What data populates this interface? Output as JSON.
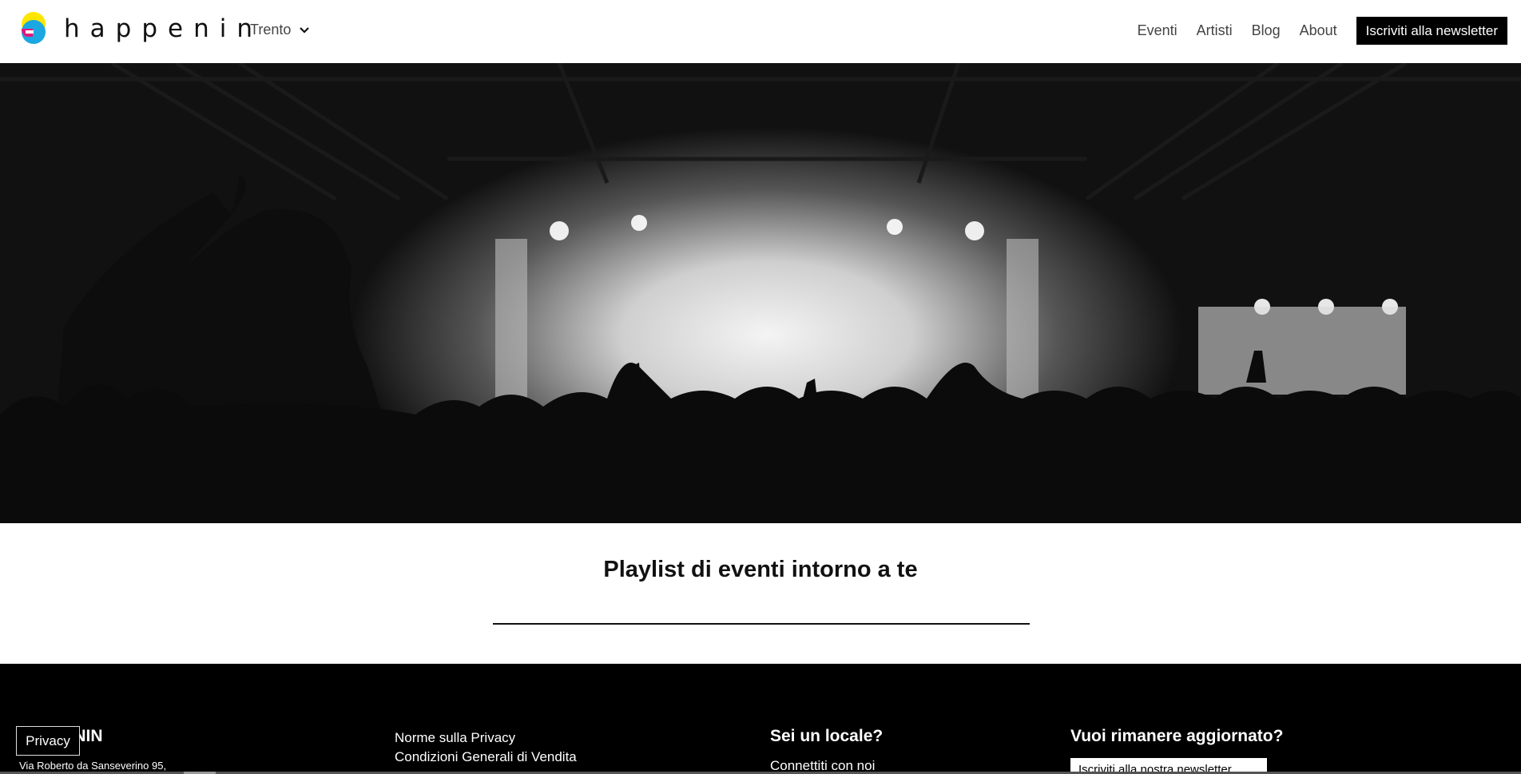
{
  "brand": {
    "name": "happenin",
    "colors": {
      "yellow": "#FFE600",
      "cyan": "#1BA7E1",
      "magenta": "#E6177A"
    }
  },
  "header": {
    "city": "Trento",
    "nav": {
      "events": "Eventi",
      "artists": "Artisti",
      "blog": "Blog",
      "about": "About"
    },
    "newsletter_button": "Iscriviti alla newsletter"
  },
  "hero": {
    "image": "concert-crowd-photo"
  },
  "playlist": {
    "title": "Playlist di eventi intorno a te"
  },
  "footer": {
    "brand": "NIN",
    "address": "Via Roberto da Sanseverino 95,",
    "links": [
      "Norme sulla Privacy",
      "Condizioni Generali di Vendita"
    ],
    "locale_title": "Sei un locale?",
    "locale_link": "Connettiti con noi",
    "news_title": "Vuoi rimanere aggiornato?",
    "news_button": "Iscriviti alla nostra newsletter"
  },
  "privacy_button": "Privacy"
}
